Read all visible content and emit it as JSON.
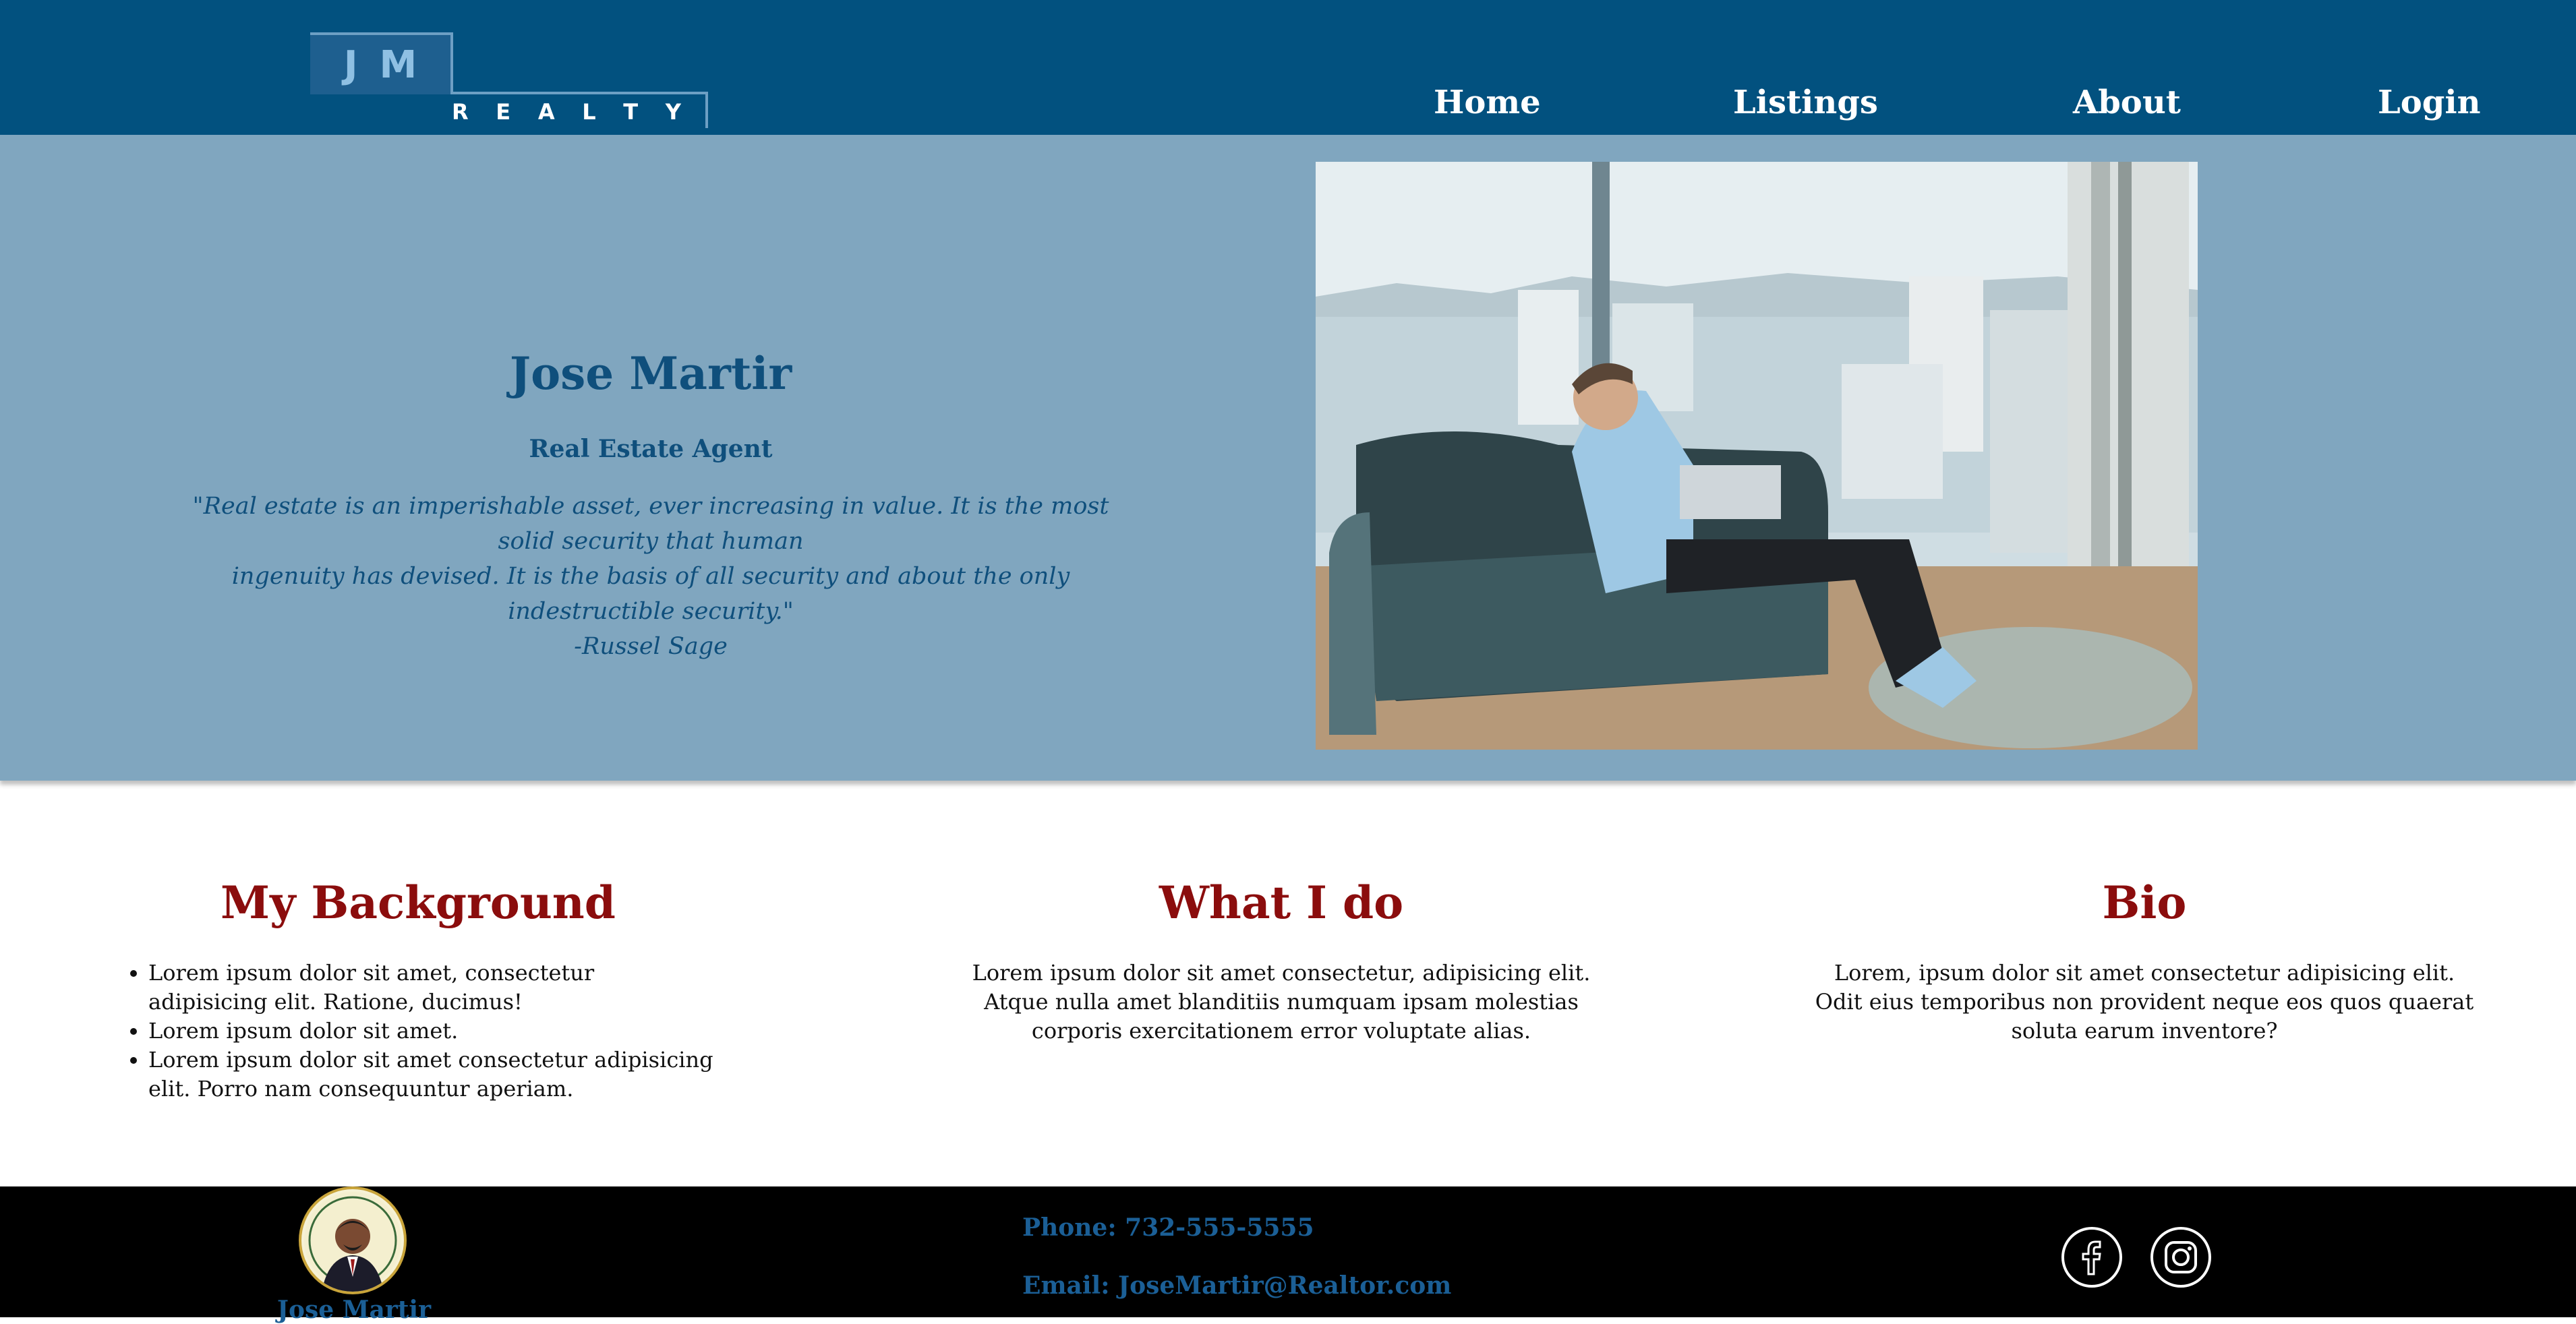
{
  "nav": {
    "logo_letters": [
      "J",
      "M"
    ],
    "logo_sub": [
      "R",
      "E",
      "A",
      "L",
      "T",
      "Y"
    ],
    "links": [
      "Home",
      "Listings",
      "About",
      "Login"
    ]
  },
  "hero": {
    "name": "Jose Martir",
    "role": "Real Estate Agent",
    "quote_line1": "\"Real estate is an imperishable asset, ever increasing in value. It is the most solid security that human",
    "quote_line2": "ingenuity has devised. It is the basis of all security and about the only indestructible security.\"",
    "quote_author": "-Russel Sage"
  },
  "sections": {
    "background": {
      "title": "My Background",
      "items": [
        "Lorem ipsum dolor sit amet, consectetur adipisicing elit. Ratione, ducimus!",
        "Lorem ipsum dolor sit amet.",
        "Lorem ipsum dolor sit amet consectetur adipisicing elit. Porro nam consequuntur aperiam."
      ]
    },
    "what": {
      "title": "What I do",
      "text": "Lorem ipsum dolor sit amet consectetur, adipisicing elit. Atque nulla amet blanditiis numquam ipsam molestias corporis exercitationem error voluptate alias."
    },
    "bio": {
      "title": "Bio",
      "text": "Lorem, ipsum dolor sit amet consectetur adipisicing elit. Odit eius temporibus non provident neque eos quos quaerat soluta earum inventore?"
    }
  },
  "footer": {
    "name": "Jose Martir",
    "phone": "Phone: 732-555-5555",
    "email": "Email: JoseMartir@Realtor.com",
    "social": [
      "facebook-icon",
      "instagram-icon"
    ]
  },
  "colors": {
    "nav": "#02517f",
    "hero": "#80a6bf",
    "heading": "#8b0d0d",
    "hero_text": "#0f4f7c",
    "footer": "#000000"
  }
}
